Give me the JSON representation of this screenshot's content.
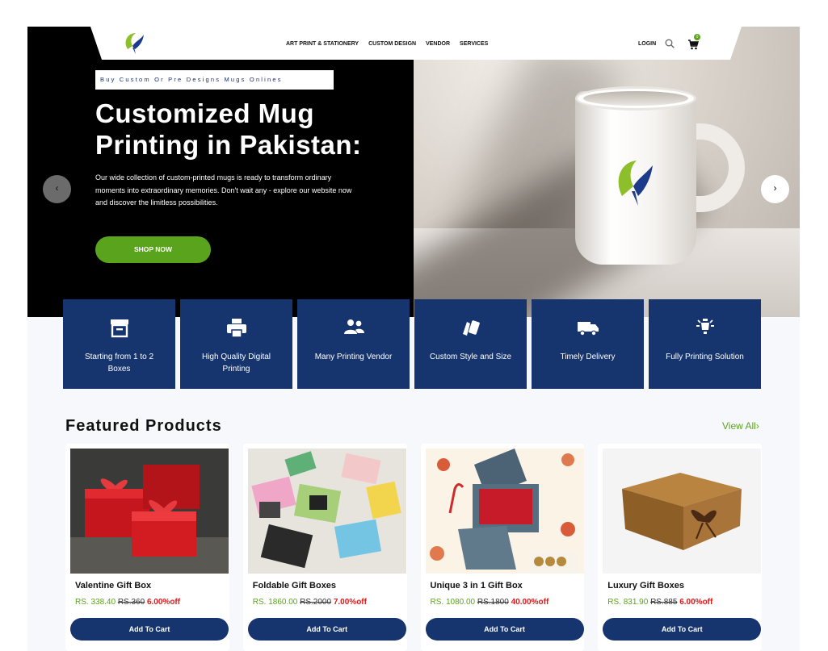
{
  "nav": {
    "menu": [
      "ART PRINT & STATIONERY",
      "CUSTOM DESIGN",
      "VENDOR",
      "SERVICES"
    ],
    "login": "LOGIN",
    "cart_count": "0",
    "icons": [
      "brand-logo",
      "search-icon",
      "cart-icon"
    ]
  },
  "hero": {
    "tagline": "Buy Custom Or Pre Designs Mugs Onlines",
    "title_line1": "Customized Mug",
    "title_line2": "Printing in Pakistan:",
    "description": "Our wide collection of custom-printed mugs is ready to transform ordinary moments into extraordinary memories. Don't wait any - explore our website now and discover the limitless possibilities.",
    "cta": "SHOP NOW",
    "prev": "‹",
    "next": "›"
  },
  "features": [
    {
      "label": "Starting from 1 to 2 Boxes",
      "icon": "archive-box-icon"
    },
    {
      "label": "High Quality Digital Printing",
      "icon": "printer-icon"
    },
    {
      "label": "Many Printing Vendor",
      "icon": "users-icon"
    },
    {
      "label": "Custom Style and Size",
      "icon": "swatches-icon"
    },
    {
      "label": "Timely Delivery",
      "icon": "truck-icon"
    },
    {
      "label": "Fully Printing Solution",
      "icon": "lamp-icon"
    }
  ],
  "featured": {
    "title": "Featured Products",
    "view_all": "View All"
  },
  "products": [
    {
      "name": "Valentine Gift Box",
      "price": "RS. 338.40",
      "old_price": "RS.360",
      "discount": "6.00%off",
      "button": "Add To Cart"
    },
    {
      "name": "Foldable Gift Boxes",
      "price": "RS. 1860.00",
      "old_price": "RS.2000",
      "discount": "7.00%off",
      "button": "Add To Cart"
    },
    {
      "name": "Unique 3 in 1 Gift Box",
      "price": "RS. 1080.00",
      "old_price": "RS.1800",
      "discount": "40.00%off",
      "button": "Add To Cart"
    },
    {
      "name": "Luxury Gift Boxes",
      "price": "RS. 831.90",
      "old_price": "RS.885",
      "discount": "6.00%off",
      "button": "Add To Cart"
    }
  ],
  "colors": {
    "accent": "#5aa31d",
    "navy": "#16346e",
    "sale": "#e01818"
  }
}
